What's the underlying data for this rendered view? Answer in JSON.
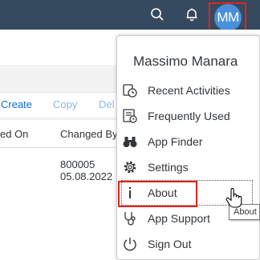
{
  "shellbar": {
    "search_icon": "search-icon",
    "bell_icon": "bell-icon",
    "avatar_initials": "MM",
    "background": "#354a5f",
    "avatar_color": "#4a90d9"
  },
  "toolbar": {
    "create_label": "Create",
    "copy_label": "Copy",
    "delete_label": "Del"
  },
  "table": {
    "headers": [
      "ed On",
      "Changed By"
    ],
    "row": {
      "changed_by": "800005",
      "changed_on": "05.08.2022"
    }
  },
  "user_menu": {
    "name": "Massimo Manara",
    "items": [
      {
        "label": "Recent Activities",
        "icon": "recent-activities-icon"
      },
      {
        "label": "Frequently Used",
        "icon": "frequently-used-icon"
      },
      {
        "label": "App Finder",
        "icon": "binoculars-icon"
      },
      {
        "label": "Settings",
        "icon": "gear-icon"
      },
      {
        "label": "About",
        "icon": "info-icon"
      },
      {
        "label": "App Support",
        "icon": "stethoscope-icon"
      },
      {
        "label": "Sign Out",
        "icon": "power-icon"
      }
    ],
    "tooltip": "About"
  },
  "colors": {
    "highlight": "#e1251b",
    "link": "#0a6ed1",
    "disabled": "#89b8e6"
  }
}
